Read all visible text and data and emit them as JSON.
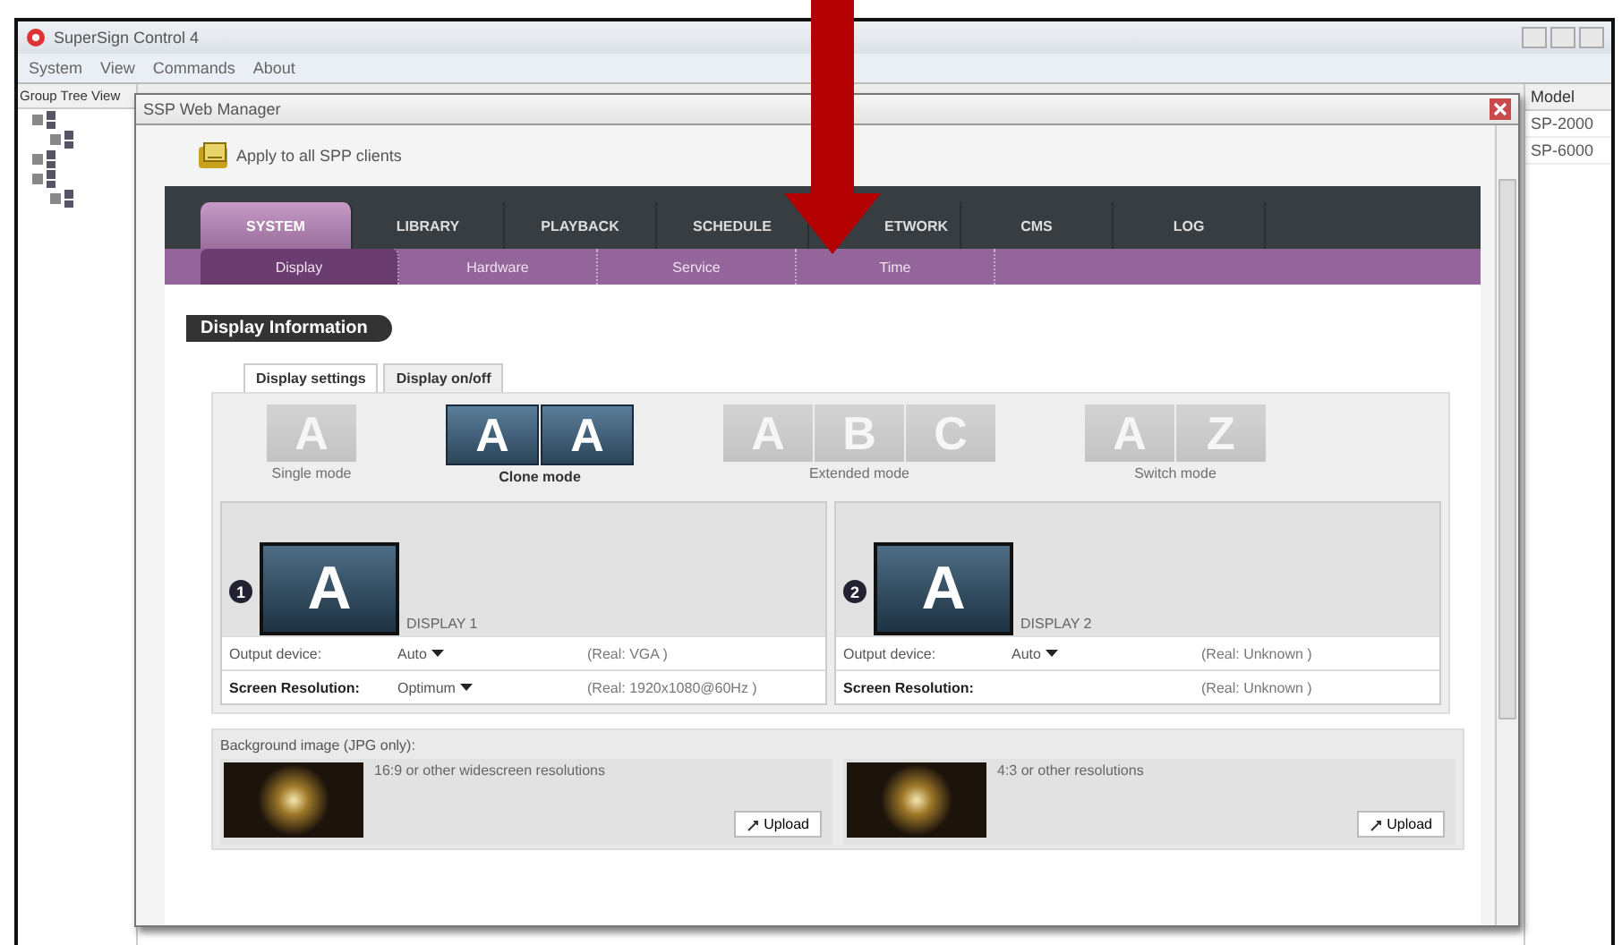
{
  "app": {
    "title": "SuperSign Control 4",
    "menu": [
      "System",
      "View",
      "Commands",
      "About"
    ],
    "tree_header": "Group Tree View"
  },
  "right_panel": {
    "header": "Model",
    "rows": [
      "SP-2000",
      "SP-6000"
    ]
  },
  "dialog": {
    "title": "SSP Web Manager",
    "apply_label": "Apply to all SPP clients",
    "tabs": [
      {
        "label": "SYSTEM",
        "selected": true
      },
      {
        "label": "LIBRARY",
        "selected": false
      },
      {
        "label": "PLAYBACK",
        "selected": false
      },
      {
        "label": "SCHEDULE",
        "selected": false
      },
      {
        "label": "ETWORK",
        "selected": false
      },
      {
        "label": "CMS",
        "selected": false
      },
      {
        "label": "LOG",
        "selected": false
      }
    ],
    "subtabs": [
      {
        "label": "Display",
        "selected": true
      },
      {
        "label": "Hardware",
        "selected": false
      },
      {
        "label": "Service",
        "selected": false
      },
      {
        "label": "Time",
        "selected": false
      }
    ],
    "section_title": "Display Information",
    "panel_tabs": [
      {
        "label": "Display settings",
        "selected": true
      },
      {
        "label": "Display on/off",
        "selected": false
      }
    ],
    "modes": [
      {
        "label": "Single mode",
        "letters": [
          "A"
        ],
        "selected": false
      },
      {
        "label": "Clone mode",
        "letters": [
          "A",
          "A"
        ],
        "selected": true
      },
      {
        "label": "Extended mode",
        "letters": [
          "A",
          "B",
          "C"
        ],
        "selected": false
      },
      {
        "label": "Switch mode",
        "letters": [
          "A",
          "Z"
        ],
        "selected": false
      }
    ],
    "displays": [
      {
        "number": "1",
        "letter": "A",
        "name": "DISPLAY 1",
        "rows": [
          {
            "label": "Output device:",
            "value": "Auto",
            "real": "(Real: VGA )"
          },
          {
            "label": "Screen Resolution:",
            "value": "Optimum",
            "real": "(Real: 1920x1080@60Hz )"
          }
        ]
      },
      {
        "number": "2",
        "letter": "A",
        "name": "DISPLAY 2",
        "rows": [
          {
            "label": "Output device:",
            "value": "Auto",
            "real": "(Real: Unknown )"
          },
          {
            "label": "Screen Resolution:",
            "real": "(Real: Unknown )"
          }
        ]
      }
    ],
    "background": {
      "label": "Background image (JPG only):",
      "items": [
        {
          "caption": "16:9 or other widescreen resolutions",
          "button": "Upload"
        },
        {
          "caption": "4:3 or other resolutions",
          "button": "Upload"
        }
      ]
    }
  }
}
